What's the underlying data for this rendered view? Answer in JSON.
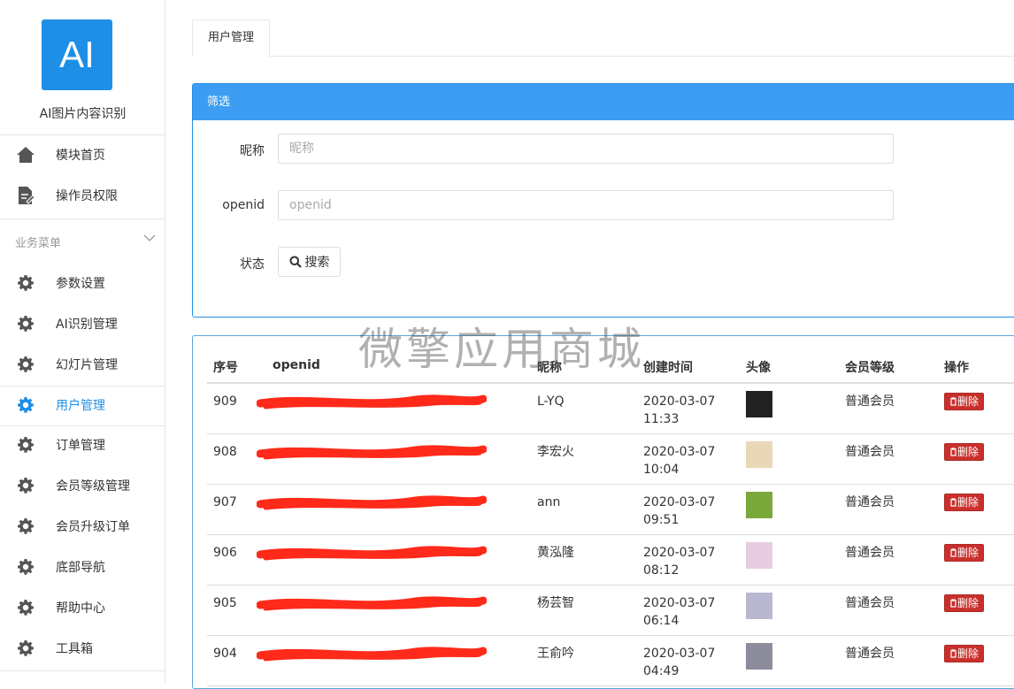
{
  "sidebar": {
    "logo_text": "AI",
    "logo_color": "#1e8fe6",
    "app_name": "AI图片内容识别",
    "top_items": [
      {
        "label": "模块首页",
        "icon": "home-icon"
      },
      {
        "label": "操作员权限",
        "icon": "edit-document-icon"
      }
    ],
    "group_title": "业务菜单",
    "items": [
      {
        "label": "参数设置",
        "icon": "gear-icon"
      },
      {
        "label": "AI识别管理",
        "icon": "gear-icon"
      },
      {
        "label": "幻灯片管理",
        "icon": "gear-icon"
      },
      {
        "label": "用户管理",
        "icon": "gear-icon",
        "active": true
      },
      {
        "label": "订单管理",
        "icon": "gear-icon"
      },
      {
        "label": "会员等级管理",
        "icon": "gear-icon"
      },
      {
        "label": "会员升级订单",
        "icon": "gear-icon"
      },
      {
        "label": "底部导航",
        "icon": "gear-icon"
      },
      {
        "label": "帮助中心",
        "icon": "gear-icon"
      },
      {
        "label": "工具箱",
        "icon": "gear-icon"
      }
    ]
  },
  "tabs": [
    {
      "label": "用户管理"
    }
  ],
  "filter": {
    "title": "筛选",
    "nickname_label": "昵称",
    "nickname_placeholder": "昵称",
    "openid_label": "openid",
    "openid_placeholder": "openid",
    "status_label": "状态",
    "search_button": "搜索"
  },
  "table": {
    "headers": [
      "序号",
      "openid",
      "昵称",
      "创建时间",
      "头像",
      "会员等级",
      "操作"
    ],
    "rows": [
      {
        "id": "909",
        "nickname": "L-YQ",
        "date": "2020-03-07",
        "time": "11:33",
        "level": "普通会员",
        "action": "删除",
        "avatar_color": "#222222"
      },
      {
        "id": "908",
        "nickname": "李宏火",
        "date": "2020-03-07",
        "time": "10:04",
        "level": "普通会员",
        "action": "删除",
        "avatar_color": "#e8d8b8"
      },
      {
        "id": "907",
        "nickname": "ann",
        "date": "2020-03-07",
        "time": "09:51",
        "level": "普通会员",
        "action": "删除",
        "avatar_color": "#7aa83a"
      },
      {
        "id": "906",
        "nickname": "黄泓隆",
        "date": "2020-03-07",
        "time": "08:12",
        "level": "普通会员",
        "action": "删除",
        "avatar_color": "#e6cde0"
      },
      {
        "id": "905",
        "nickname": "杨芸智",
        "date": "2020-03-07",
        "time": "06:14",
        "level": "普通会员",
        "action": "删除",
        "avatar_color": "#b8b8d0"
      },
      {
        "id": "904",
        "nickname": "王俞吟",
        "date": "2020-03-07",
        "time": "04:49",
        "level": "普通会员",
        "action": "删除",
        "avatar_color": "#8c8c9c"
      }
    ]
  },
  "watermark": "微擎应用商城",
  "colors": {
    "accent": "#1e8fe6",
    "danger": "#c9302c",
    "redaction": "#ff2a1a"
  }
}
